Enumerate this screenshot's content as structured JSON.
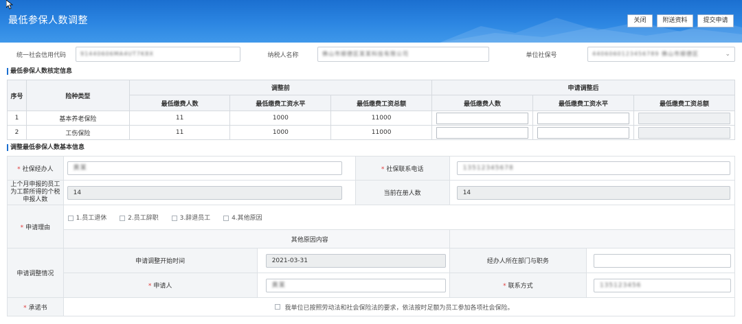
{
  "header": {
    "title": "最低参保人数调整",
    "buttons": {
      "close": "关闭",
      "attach": "附送资料",
      "submit": "提交申请"
    }
  },
  "top": {
    "credit_code_label": "统一社会信用代码",
    "credit_code_value": "91440606MA4UT7K8X",
    "taxpayer_label": "纳税人名称",
    "taxpayer_value": "佛山市顺德区某某科技有限公司",
    "social_no_label": "单位社保号",
    "social_no_value": "4406060123456789 佛山市顺德区"
  },
  "section1": {
    "title": "最低参保人数核定信息",
    "headers": {
      "seq": "序号",
      "type": "险种类型",
      "before": "调整前",
      "after": "申请调整后",
      "min_people": "最低缴费人数",
      "min_wage": "最低缴费工资水平",
      "min_total": "最低缴费工资总额"
    },
    "rows": [
      {
        "seq": "1",
        "type": "基本养老保险",
        "people": "11",
        "wage": "1000",
        "total": "11000"
      },
      {
        "seq": "2",
        "type": "工伤保险",
        "people": "11",
        "wage": "1000",
        "total": "11000"
      }
    ]
  },
  "section2": {
    "title": "调整最低参保人数基本信息",
    "agent_label": "社保经办人",
    "agent_value": "黄某",
    "phone_label": "社保联系电话",
    "phone_value": "13512345678",
    "last_month_label": "上个月申报的员工为工薪所得的个税申报人数",
    "last_month_value": "14",
    "current_label": "当前在册人数",
    "current_value": "14",
    "reason_label": "申请理由",
    "reasons": [
      "1.员工退休",
      "2.员工辞职",
      "3.辞退员工",
      "4.其他原因"
    ],
    "other_reason_label": "其他原因内容",
    "situation_label": "申请调整情况",
    "start_time_label": "申请调整开始时间",
    "start_time_value": "2021-03-31",
    "dept_label": "经办人所在部门与职务",
    "applicant_label": "申请人",
    "applicant_value": "黄某",
    "contact_label": "联系方式",
    "contact_value": "135123456",
    "promise_label": "承诺书",
    "promise_text": "我单位已按照劳动法和社会保险法的要求，依法按时足额为员工参加各项社会保险。"
  }
}
